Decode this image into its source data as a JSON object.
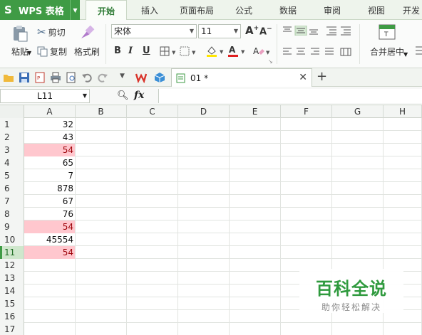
{
  "app": {
    "logo": "S",
    "name": "WPS 表格"
  },
  "menu_tabs": [
    {
      "label": "开始",
      "active": true
    },
    {
      "label": "插入"
    },
    {
      "label": "页面布局"
    },
    {
      "label": "公式"
    },
    {
      "label": "数据"
    },
    {
      "label": "审阅"
    },
    {
      "label": "视图"
    },
    {
      "label": "开发"
    }
  ],
  "ribbon": {
    "paste": "粘贴",
    "cut": "剪切",
    "copy": "复制",
    "format_painter": "格式刷",
    "font_name": "宋体",
    "font_size": "11",
    "bold": "B",
    "italic": "I",
    "underline": "U",
    "merge_center": "合并居中"
  },
  "document_tab": {
    "name": "01 *"
  },
  "formula_bar": {
    "name_box": "L11",
    "fx": "fx",
    "content": ""
  },
  "columns": [
    "A",
    "B",
    "C",
    "D",
    "E",
    "F",
    "G",
    "H"
  ],
  "rows": [
    {
      "num": "1",
      "a": "32"
    },
    {
      "num": "2",
      "a": "43"
    },
    {
      "num": "3",
      "a": "54",
      "highlight": true
    },
    {
      "num": "4",
      "a": "65"
    },
    {
      "num": "5",
      "a": "7"
    },
    {
      "num": "6",
      "a": "878"
    },
    {
      "num": "7",
      "a": "67"
    },
    {
      "num": "8",
      "a": "76"
    },
    {
      "num": "9",
      "a": "54",
      "highlight": true
    },
    {
      "num": "10",
      "a": "45554"
    },
    {
      "num": "11",
      "a": "54",
      "highlight": true,
      "selected": true
    },
    {
      "num": "12",
      "a": ""
    },
    {
      "num": "13",
      "a": ""
    },
    {
      "num": "14",
      "a": ""
    },
    {
      "num": "15",
      "a": ""
    },
    {
      "num": "16",
      "a": ""
    },
    {
      "num": "17",
      "a": ""
    }
  ],
  "watermark": {
    "title": "百科全说",
    "subtitle": "助你轻松解决"
  },
  "colors": {
    "accent": "#3f9b45",
    "highlight_fill": "#ffc7ce",
    "highlight_text": "#9c0006"
  }
}
